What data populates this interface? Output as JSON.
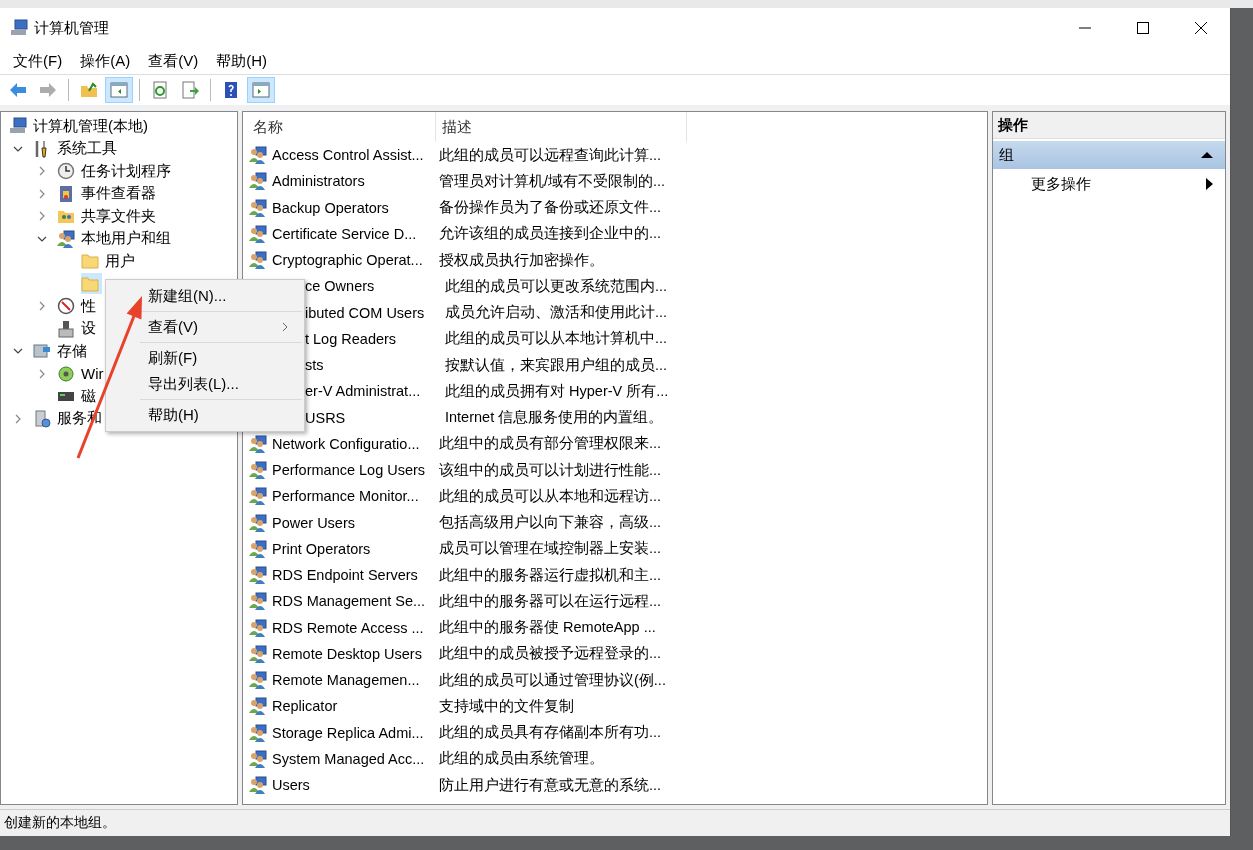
{
  "window": {
    "title": "计算机管理"
  },
  "menu_bar": [
    "文件(F)",
    "操作(A)",
    "查看(V)",
    "帮助(H)"
  ],
  "toolbar": [
    {
      "kind": "button",
      "disabled": false,
      "pressed": false
    },
    {
      "kind": "button",
      "disabled": true,
      "pressed": false
    },
    {
      "kind": "separator"
    },
    {
      "kind": "button",
      "disabled": false,
      "pressed": false
    },
    {
      "kind": "button",
      "disabled": false,
      "pressed": true
    },
    {
      "kind": "separator"
    },
    {
      "kind": "button",
      "disabled": false,
      "pressed": false
    },
    {
      "kind": "button",
      "disabled": false,
      "pressed": false
    },
    {
      "kind": "separator"
    },
    {
      "kind": "button",
      "disabled": false,
      "pressed": false
    },
    {
      "kind": "button",
      "disabled": false,
      "pressed": true
    }
  ],
  "tree": {
    "label": "计算机管理(本地)",
    "selected": false,
    "children": [
      {
        "label": "系统工具",
        "expanded": true,
        "selected": false,
        "children": [
          {
            "label": "任务计划程序",
            "expanded": false,
            "selected": false
          },
          {
            "label": "事件查看器",
            "expanded": false,
            "selected": false
          },
          {
            "label": "共享文件夹",
            "expanded": false,
            "selected": false
          },
          {
            "label": "本地用户和组",
            "expanded": true,
            "selected": false,
            "children": [
              {
                "label": "用户",
                "selected": false
              },
              {
                "selected": true
              }
            ]
          },
          {
            "label": "性",
            "expanded": false,
            "selected": false
          },
          {
            "label": "设",
            "selected": false
          }
        ]
      },
      {
        "label": "存储",
        "expanded": true,
        "selected": false,
        "children": [
          {
            "label": "Wir",
            "expanded": false,
            "selected": false
          },
          {
            "label": "磁",
            "selected": false
          }
        ]
      },
      {
        "label": "服务和",
        "expanded": false,
        "selected": false
      }
    ]
  },
  "list": {
    "columns": [
      "名称",
      "描述"
    ],
    "rows": [
      {
        "name": "Access Control Assist...",
        "description": "此组的成员可以远程查询此计算...",
        "covered": false
      },
      {
        "name": "Administrators",
        "description": "管理员对计算机/域有不受限制的...",
        "covered": false
      },
      {
        "name": "Backup Operators",
        "description": "备份操作员为了备份或还原文件...",
        "covered": false
      },
      {
        "name": "Certificate Service D...",
        "description": "允许该组的成员连接到企业中的...",
        "covered": false
      },
      {
        "name": "Cryptographic Operat...",
        "description": "授权成员执行加密操作。",
        "covered": false
      },
      {
        "name": "ce Owners",
        "description": "此组的成员可以更改系统范围内...",
        "covered": true
      },
      {
        "name": "ibuted COM Users",
        "description": "成员允许启动、激活和使用此计...",
        "covered": true
      },
      {
        "name": "t Log Readers",
        "description": "此组的成员可以从本地计算机中...",
        "covered": true
      },
      {
        "name": "sts",
        "description": "按默认值，来宾跟用户组的成员...",
        "covered": true
      },
      {
        "name": "er-V Administrat...",
        "description": "此组的成员拥有对 Hyper-V 所有...",
        "covered": true
      },
      {
        "name": "USRS",
        "description": "Internet 信息服务使用的内置组。",
        "covered": true
      },
      {
        "name": "Network Configuratio...",
        "description": "此组中的成员有部分管理权限来...",
        "covered": false
      },
      {
        "name": "Performance Log Users",
        "description": "该组中的成员可以计划进行性能...",
        "covered": false
      },
      {
        "name": "Performance Monitor...",
        "description": "此组的成员可以从本地和远程访...",
        "covered": false
      },
      {
        "name": "Power Users",
        "description": "包括高级用户以向下兼容，高级...",
        "covered": false
      },
      {
        "name": "Print Operators",
        "description": "成员可以管理在域控制器上安装...",
        "covered": false
      },
      {
        "name": "RDS Endpoint Servers",
        "description": "此组中的服务器运行虚拟机和主...",
        "covered": false
      },
      {
        "name": "RDS Management Se...",
        "description": "此组中的服务器可以在运行远程...",
        "covered": false
      },
      {
        "name": "RDS Remote Access ...",
        "description": "此组中的服务器使 RemoteApp ...",
        "covered": false
      },
      {
        "name": "Remote Desktop Users",
        "description": "此组中的成员被授予远程登录的...",
        "covered": false
      },
      {
        "name": "Remote Managemen...",
        "description": "此组的成员可以通过管理协议(例...",
        "covered": false
      },
      {
        "name": "Replicator",
        "description": "支持域中的文件复制",
        "covered": false
      },
      {
        "name": "Storage Replica Admi...",
        "description": "此组的成员具有存储副本所有功...",
        "covered": false
      },
      {
        "name": "System Managed Acc...",
        "description": "此组的成员由系统管理。",
        "covered": false
      },
      {
        "name": "Users",
        "description": "防止用户进行有意或无意的系统...",
        "covered": false
      }
    ]
  },
  "actions": {
    "title": "操作",
    "sections": [
      {
        "label": "组",
        "expanded": true,
        "items": [
          {
            "label": "更多操作",
            "submenu": true
          }
        ]
      }
    ]
  },
  "context_menu": [
    {
      "kind": "item",
      "label": "新建组(N)...",
      "submenu": false
    },
    {
      "kind": "separator"
    },
    {
      "kind": "item",
      "label": "查看(V)",
      "submenu": true
    },
    {
      "kind": "separator"
    },
    {
      "kind": "item",
      "label": "刷新(F)",
      "submenu": false
    },
    {
      "kind": "item",
      "label": "导出列表(L)...",
      "submenu": false
    },
    {
      "kind": "separator"
    },
    {
      "kind": "item",
      "label": "帮助(H)",
      "submenu": false
    }
  ],
  "status_bar": "创建新的本地组。"
}
